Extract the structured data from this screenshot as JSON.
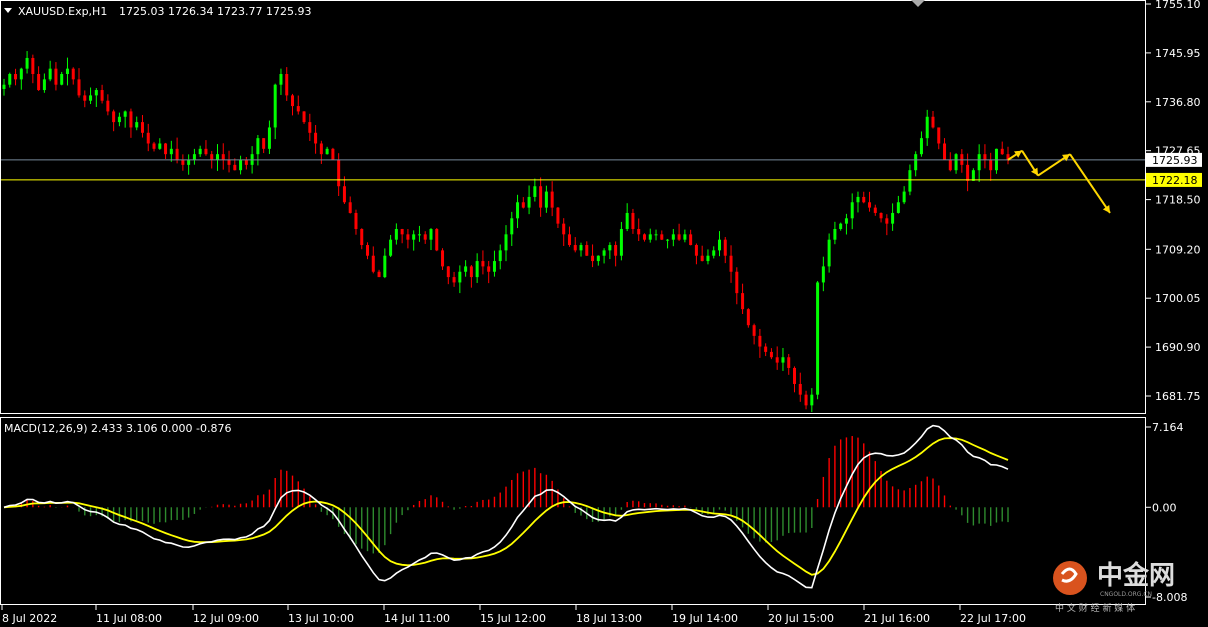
{
  "colors": {
    "bull": "#00ff00",
    "bear": "#ff0000",
    "grid": "#ffffff",
    "current_line": "#778899",
    "level_line": "#ffff00",
    "macd_line": "#ffffff",
    "signal_line": "#ffff00",
    "hist_pos": "#ff0000",
    "hist_neg": "#2e8b2e",
    "forecast": "#ffd700"
  },
  "header": {
    "symbol_label": "XAUUSD.Exp,H1",
    "ohlc": "1725.03 1726.34 1723.77 1725.93"
  },
  "macd_header": {
    "label": "MACD(12,26,9) 2.433 3.106 0.000 -0.876"
  },
  "watermark": {
    "brand_cn": "中金网",
    "brand_en": "CNGOLD.ORG.CN",
    "tagline": "中 文 财 经 新 媒 体"
  },
  "chart_data": [
    {
      "type": "candlestick",
      "symbol": "XAUUSD.Exp",
      "timeframe": "H1",
      "ylim": [
        1677,
        1755.1
      ],
      "y_ticks": [
        "1755.10",
        "1745.95",
        "1736.80",
        "1727.65",
        "1718.50",
        "1709.20",
        "1700.05",
        "1690.90",
        "1681.75"
      ],
      "x_ticks": [
        "8 Jul 2022",
        "11 Jul 08:00",
        "12 Jul 09:00",
        "13 Jul 10:00",
        "14 Jul 11:00",
        "15 Jul 12:00",
        "18 Jul 13:00",
        "19 Jul 14:00",
        "20 Jul 15:00",
        "21 Jul 16:00",
        "22 Jul 17:00"
      ],
      "current_price": 1725.93,
      "current_price_label": "1725.93",
      "horizontal_level": 1722.18,
      "horizontal_level_label": "1722.18",
      "closes": [
        1740,
        1742,
        1741,
        1743,
        1745,
        1742,
        1739,
        1741,
        1743,
        1740,
        1742,
        1743,
        1741,
        1738,
        1737,
        1738,
        1739,
        1737,
        1735,
        1733,
        1734,
        1735,
        1732,
        1733,
        1731,
        1729,
        1728,
        1729,
        1727,
        1728,
        1726,
        1725,
        1726,
        1727,
        1728,
        1727,
        1726,
        1727,
        1726,
        1725,
        1724,
        1726,
        1725,
        1727,
        1730,
        1728,
        1732,
        1740,
        1742,
        1738,
        1736,
        1735,
        1733,
        1731,
        1729,
        1727,
        1728,
        1726,
        1721,
        1718,
        1716,
        1713,
        1710,
        1708,
        1705,
        1704,
        1708,
        1711,
        1713,
        1712,
        1711,
        1712,
        1712,
        1711,
        1713,
        1709,
        1706,
        1704,
        1703,
        1705,
        1706,
        1704,
        1707,
        1706,
        1705,
        1707,
        1709,
        1712,
        1715,
        1718,
        1717,
        1719,
        1721,
        1717,
        1720,
        1717,
        1714,
        1712,
        1710,
        1709,
        1710,
        1708,
        1707,
        1708,
        1709,
        1710,
        1708,
        1713,
        1716,
        1713,
        1712,
        1711,
        1712,
        1712,
        1711,
        1711,
        1712,
        1711,
        1712,
        1710,
        1708,
        1707,
        1708,
        1709,
        1711,
        1708,
        1705,
        1701,
        1698,
        1695,
        1693,
        1691,
        1690,
        1689,
        1688,
        1689,
        1687,
        1684,
        1682,
        1680,
        1682,
        1703,
        1706,
        1711,
        1713,
        1714,
        1715,
        1718,
        1719,
        1718,
        1717,
        1716,
        1715,
        1714,
        1716,
        1718,
        1720,
        1724,
        1727,
        1730,
        1734,
        1732,
        1729,
        1726,
        1724,
        1727,
        1725,
        1722,
        1724,
        1727,
        1726,
        1724,
        1728,
        1727,
        1725.93
      ],
      "forecast_path": [
        1727.65,
        1723,
        1727,
        1716
      ],
      "indicator": {
        "name": "MACD(12,26,9)",
        "macd": 2.433,
        "signal": 3.106,
        "level": 0.0,
        "histogram": -0.876,
        "y_ticks": [
          "7.164",
          "0.00",
          "-8.008"
        ],
        "ylim": [
          -8.008,
          7.164
        ]
      }
    }
  ]
}
